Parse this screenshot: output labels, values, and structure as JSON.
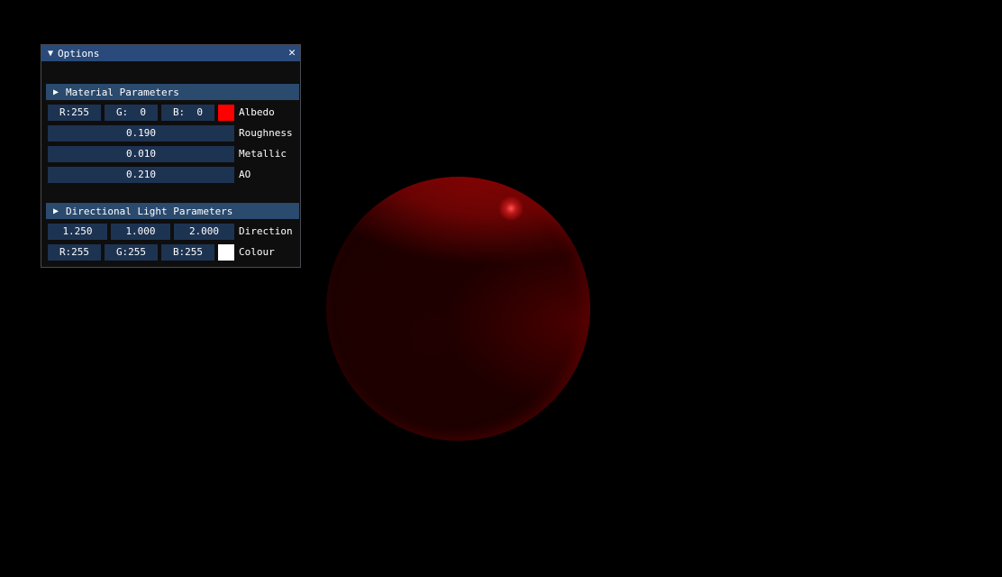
{
  "window": {
    "title": "Options",
    "title_arrow": "▼",
    "close_glyph": "✕"
  },
  "material": {
    "header_arrow": "▶",
    "header": "Material Parameters",
    "albedo": {
      "r": "R:255",
      "g": "G:  0",
      "b": "B:  0",
      "swatch_color": "#ff0000",
      "label": "Albedo"
    },
    "roughness": {
      "value": "0.190",
      "label": "Roughness"
    },
    "metallic": {
      "value": "0.010",
      "label": "Metallic"
    },
    "ao": {
      "value": "0.210",
      "label": "AO"
    }
  },
  "light": {
    "header_arrow": "▶",
    "header": "Directional Light Parameters",
    "direction": {
      "x": "1.250",
      "y": "1.000",
      "z": "2.000",
      "label": "Direction"
    },
    "colour": {
      "r": "R:255",
      "g": "G:255",
      "b": "B:255",
      "swatch_color": "#ffffff",
      "label": "Colour"
    }
  },
  "colors": {
    "background": "#000000",
    "title_bar": "#294a7a",
    "header": "#2a4a6e",
    "field": "#1d3352",
    "sphere": "#8b0000"
  }
}
